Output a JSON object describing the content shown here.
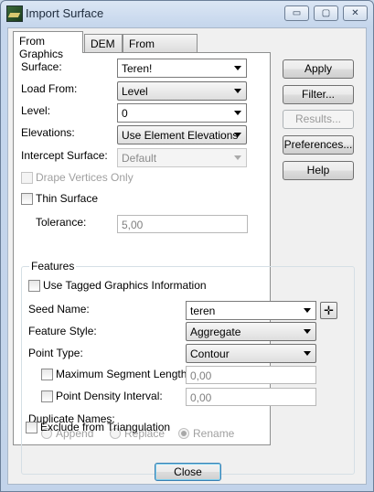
{
  "window": {
    "title": "Import Surface"
  },
  "tabs": [
    {
      "label": "From Graphics"
    },
    {
      "label": "DEM"
    },
    {
      "label": "From Geometry"
    }
  ],
  "form": {
    "surface": {
      "label": "Surface:",
      "value": "Teren!"
    },
    "load_from": {
      "label": "Load From:",
      "value": "Level"
    },
    "level": {
      "label": "Level:",
      "value": "0"
    },
    "elevations": {
      "label": "Elevations:",
      "value": "Use Element Elevations"
    },
    "intercept_surface": {
      "label": "Intercept Surface:",
      "value": "Default"
    },
    "drape_vertices_only": {
      "label": "Drape Vertices Only"
    },
    "thin_surface": {
      "label": "Thin Surface"
    },
    "tolerance": {
      "label": "Tolerance:",
      "value": "5,00"
    }
  },
  "features": {
    "title": "Features",
    "use_tagged_graphics": {
      "label": "Use Tagged Graphics Information"
    },
    "seed_name": {
      "label": "Seed Name:",
      "value": "teren"
    },
    "feature_style": {
      "label": "Feature Style:",
      "value": "Aggregate"
    },
    "point_type": {
      "label": "Point Type:",
      "value": "Contour"
    },
    "max_segment_length": {
      "label": "Maximum Segment Length:",
      "value": "0,00"
    },
    "point_density_interval": {
      "label": "Point Density Interval:",
      "value": "0,00"
    },
    "duplicate_names": {
      "label": "Duplicate Names:",
      "options": [
        "Append",
        "Replace",
        "Rename"
      ],
      "selected": "Rename"
    },
    "exclude_from_triangulation": {
      "label": "Exclude from Triangulation"
    }
  },
  "buttons": {
    "apply": "Apply",
    "filter": "Filter...",
    "results": "Results...",
    "preferences": "Preferences...",
    "help": "Help",
    "close": "Close"
  },
  "titlebar_buttons": {
    "minimize": "▭",
    "maximize": "▢",
    "close": "✕"
  }
}
